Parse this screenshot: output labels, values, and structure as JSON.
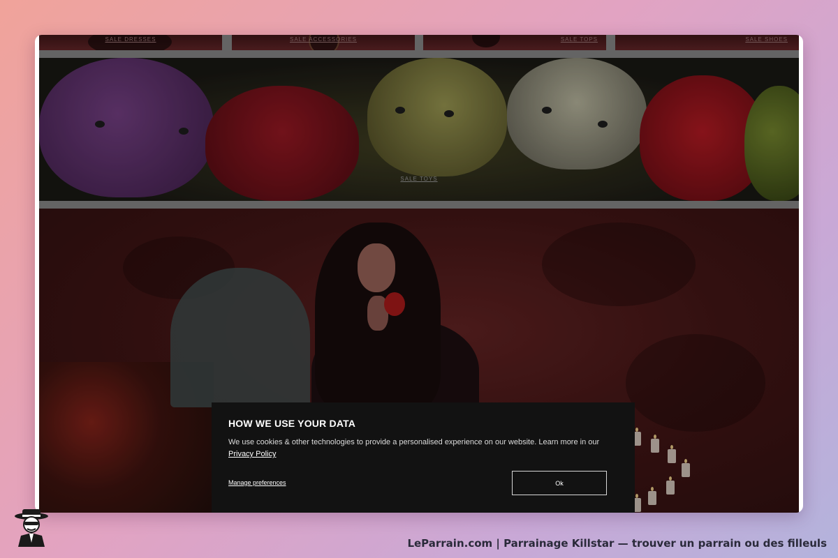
{
  "categories": [
    {
      "label": "SALE DRESSES"
    },
    {
      "label": "SALE ACCESSORIES"
    },
    {
      "label": "SALE TOPS"
    },
    {
      "label": "SALE SHOES"
    }
  ],
  "toys_banner": {
    "label": "SALE TOYS"
  },
  "cookie_banner": {
    "title": "HOW WE USE YOUR DATA",
    "body": "We use cookies & other technologies to provide a personalised experience on our website. Learn more in our",
    "privacy_link": "Privacy Policy",
    "manage_label": "Manage preferences",
    "ok_label": "Ok"
  },
  "footer": {
    "caption": "LeParrain.com | Parrainage Killstar — trouver un parrain ou des filleuls"
  },
  "colors": {
    "modal_bg": "#121212",
    "hero_red": "#4a1818",
    "page_gap": "#7a7a7a"
  }
}
